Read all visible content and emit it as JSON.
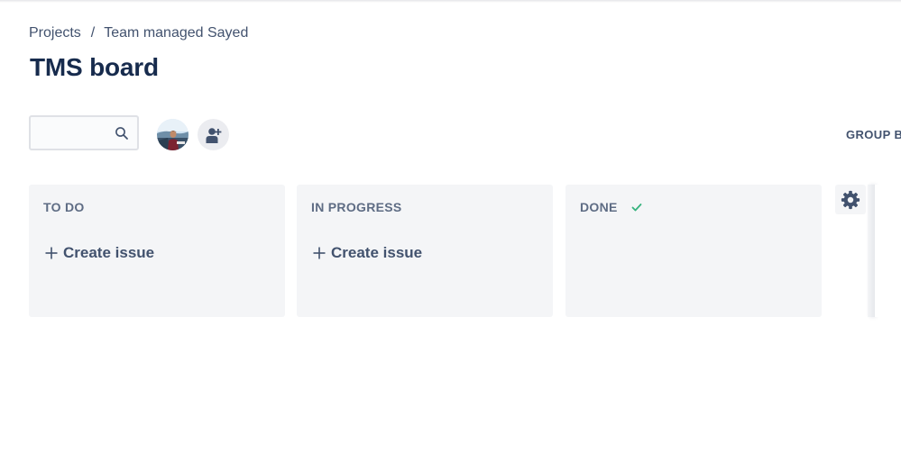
{
  "breadcrumb": {
    "projects": "Projects",
    "separator": "/",
    "project_name": "Team managed Sayed"
  },
  "page": {
    "title": "TMS board"
  },
  "toolbar": {
    "search_value": "",
    "search_icon": "search-icon",
    "avatar_icon": "user-avatar",
    "add_people_icon": "add-person-icon",
    "group_by_label": "GROUP BY"
  },
  "columns": [
    {
      "title": "TO DO",
      "create_label": "Create issue"
    },
    {
      "title": "IN PROGRESS",
      "create_label": "Create issue"
    },
    {
      "title": "DONE",
      "done_icon": "check-icon"
    }
  ],
  "board_settings_icon": "gear-icon",
  "colors": {
    "text_primary": "#172b4d",
    "text_secondary": "#42526e",
    "column_bg": "#f4f5f7",
    "done_check": "#36b37e"
  }
}
